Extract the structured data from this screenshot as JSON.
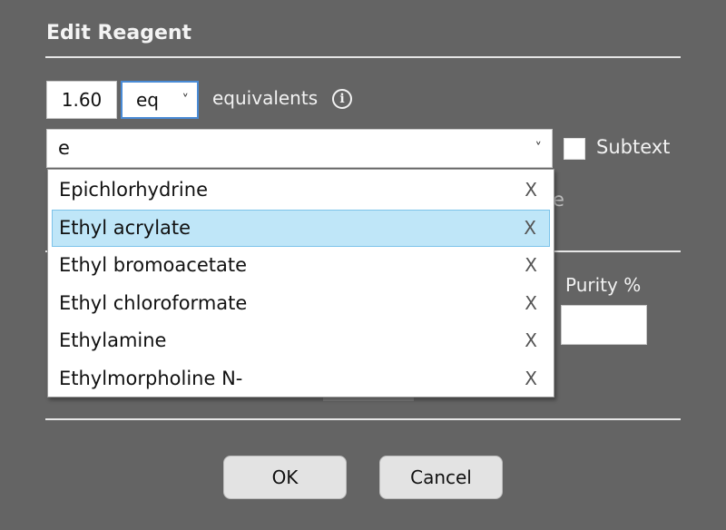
{
  "dialog": {
    "title": "Edit Reagent"
  },
  "amount": {
    "value": "1.60",
    "unit": "eq",
    "unit_label": "equivalents"
  },
  "icons": {
    "info": "i",
    "chevron": "˅",
    "remove": "X"
  },
  "reagent": {
    "value": "e",
    "subtext_label": "Subtext",
    "subtext_checked": false
  },
  "dropdown": {
    "items": [
      {
        "label": "Epichlorhydrine",
        "selected": false
      },
      {
        "label": "Ethyl acrylate",
        "selected": true
      },
      {
        "label": "Ethyl bromoacetate",
        "selected": false
      },
      {
        "label": "Ethyl chloroformate",
        "selected": false
      },
      {
        "label": "Ethylamine",
        "selected": false
      },
      {
        "label": "Ethylmorpholine N-",
        "selected": false
      }
    ]
  },
  "obscured": {
    "fragment": "e"
  },
  "purity": {
    "label": "Purity %",
    "value": ""
  },
  "buttons": {
    "ok": "OK",
    "cancel": "Cancel"
  },
  "colors": {
    "background": "#646464",
    "selection": "#bfe6f8",
    "focus_border": "#4a8bd6"
  }
}
